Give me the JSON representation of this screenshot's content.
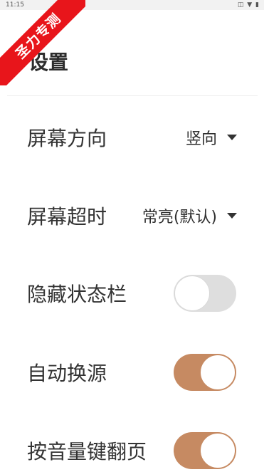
{
  "status_bar": {
    "time": "11:15",
    "icons": "◫ ▼ ▮"
  },
  "watermark": "圣力专测",
  "header": {
    "title": "设置"
  },
  "settings": {
    "orientation": {
      "label": "屏幕方向",
      "value": "竖向"
    },
    "timeout": {
      "label": "屏幕超时",
      "value": "常亮(默认)"
    },
    "hide_status_bar": {
      "label": "隐藏状态栏",
      "enabled": false
    },
    "auto_switch_source": {
      "label": "自动换源",
      "enabled": true
    },
    "volume_key_page_turn": {
      "label": "按音量键翻页",
      "enabled": true
    }
  },
  "colors": {
    "toggle_on": "#c68a62",
    "toggle_off": "#dedede",
    "watermark": "#e8151b"
  }
}
